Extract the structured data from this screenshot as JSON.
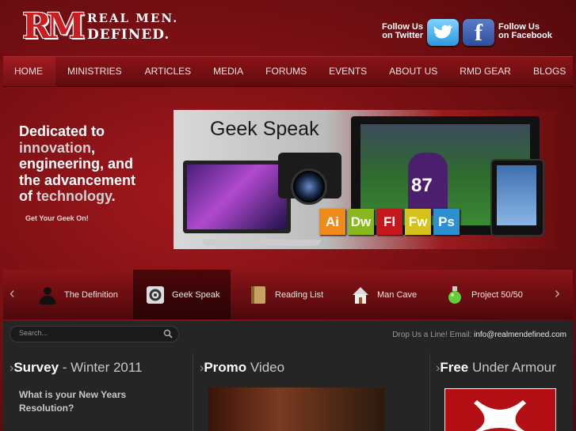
{
  "header": {
    "logo_mark": "RM",
    "logo_line1": "REAL MEN.",
    "logo_line2": "DEFINED.",
    "twitter_line1": "Follow Us",
    "twitter_line2": "on Twitter",
    "facebook_line1": "Follow Us",
    "facebook_line2": "on Facebook"
  },
  "nav": {
    "items": [
      "HOME",
      "MINISTRIES",
      "ARTICLES",
      "MEDIA",
      "FORUMS",
      "EVENTS",
      "ABOUT US",
      "RMD GEAR",
      "BLOGS"
    ]
  },
  "hero": {
    "line1": "Dedicated to",
    "line2_hl": "innovation",
    "line2_rest": ",",
    "line3": "engineering, and",
    "line4": "the advancement",
    "line5_pre": "of ",
    "line5_hl": "technology",
    "line5_post": ".",
    "cta": "Get Your Geek On!",
    "banner_title": "Geek Speak",
    "jersey_number": "87",
    "adobe_icons": [
      {
        "label": "Ai",
        "color": "#f08a1a"
      },
      {
        "label": "Dw",
        "color": "#89b81e"
      },
      {
        "label": "Fl",
        "color": "#c5161d"
      },
      {
        "label": "Fw",
        "color": "#d6c21a"
      },
      {
        "label": "Ps",
        "color": "#2c8fd0"
      }
    ]
  },
  "tabs": {
    "items": [
      {
        "label": "The Definition",
        "icon": "silhouette-icon"
      },
      {
        "label": "Geek Speak",
        "icon": "gear-icon"
      },
      {
        "label": "Reading List",
        "icon": "book-icon"
      },
      {
        "label": "Man Cave",
        "icon": "house-icon"
      },
      {
        "label": "Project 50/50",
        "icon": "potion-icon"
      }
    ],
    "active": "Geek Speak",
    "prev": "‹",
    "next": "›"
  },
  "search": {
    "placeholder": "Search..."
  },
  "contact": {
    "text": "Drop Us a Line! Email: ",
    "email": "info@realmendefined.com"
  },
  "columns": [
    {
      "bold": "Survey",
      "rest": " - Winter 2011"
    },
    {
      "bold": "Promo",
      "rest": " Video"
    },
    {
      "bold": "Free",
      "rest": " Under Armour"
    }
  ],
  "survey": {
    "question": "What is your New Years Resolution?"
  }
}
